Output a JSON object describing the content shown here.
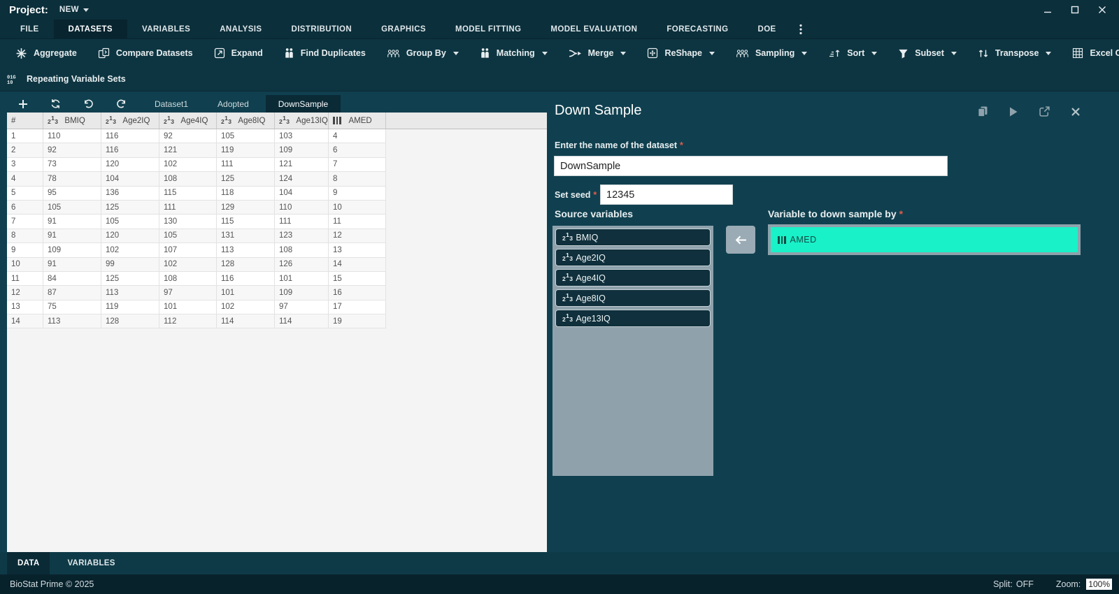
{
  "window": {
    "app_label": "Project:",
    "project_name": "NEW"
  },
  "menu": {
    "items": [
      "FILE",
      "DATASETS",
      "VARIABLES",
      "ANALYSIS",
      "DISTRIBUTION",
      "GRAPHICS",
      "MODEL FITTING",
      "MODEL EVALUATION",
      "FORECASTING",
      "DOE"
    ],
    "active": "DATASETS"
  },
  "toolbar": {
    "row1": [
      {
        "label": "Aggregate",
        "icon": "aggregate",
        "dropdown": false
      },
      {
        "label": "Compare Datasets",
        "icon": "compare",
        "dropdown": false
      },
      {
        "label": "Expand",
        "icon": "expand",
        "dropdown": false
      },
      {
        "label": "Find Duplicates",
        "icon": "people2",
        "dropdown": false
      },
      {
        "label": "Group By",
        "icon": "people3",
        "dropdown": true
      },
      {
        "label": "Matching",
        "icon": "people2",
        "dropdown": true
      },
      {
        "label": "Merge",
        "icon": "merge",
        "dropdown": true
      },
      {
        "label": "ReShape",
        "icon": "reshape",
        "dropdown": true
      },
      {
        "label": "Sampling",
        "icon": "people3",
        "dropdown": true
      },
      {
        "label": "Sort",
        "icon": "sort",
        "dropdown": true
      },
      {
        "label": "Subset",
        "icon": "subset",
        "dropdown": true
      },
      {
        "label": "Transpose",
        "icon": "transpose",
        "dropdown": true
      },
      {
        "label": "Excel Cleanup",
        "icon": "excel",
        "dropdown": false
      }
    ],
    "row2": [
      {
        "label": "Repeating Variable Sets",
        "icon": "repeating",
        "dropdown": false
      }
    ]
  },
  "dataset_tabs": {
    "actions": [
      {
        "name": "add-dataset",
        "icon": "add"
      },
      {
        "name": "refresh",
        "icon": "refresh"
      },
      {
        "name": "undo",
        "icon": "undo"
      },
      {
        "name": "redo",
        "icon": "redo"
      }
    ],
    "tabs": [
      "Dataset1",
      "Adopted",
      "DownSample"
    ],
    "active": "DownSample"
  },
  "table": {
    "columns": [
      {
        "label": "#",
        "type": "index"
      },
      {
        "label": "BMIQ",
        "type": "numeric"
      },
      {
        "label": "Age2IQ",
        "type": "numeric"
      },
      {
        "label": "Age4IQ",
        "type": "numeric"
      },
      {
        "label": "Age8IQ",
        "type": "numeric"
      },
      {
        "label": "Age13IQ",
        "type": "numeric"
      },
      {
        "label": "AMED",
        "type": "factor"
      }
    ],
    "rows": [
      [
        1,
        110,
        116,
        92,
        105,
        103,
        4
      ],
      [
        2,
        92,
        116,
        121,
        119,
        109,
        6
      ],
      [
        3,
        73,
        120,
        102,
        111,
        121,
        7
      ],
      [
        4,
        78,
        104,
        108,
        125,
        124,
        8
      ],
      [
        5,
        95,
        136,
        115,
        118,
        104,
        9
      ],
      [
        6,
        105,
        125,
        111,
        129,
        110,
        10
      ],
      [
        7,
        91,
        105,
        130,
        115,
        111,
        11
      ],
      [
        8,
        91,
        120,
        105,
        131,
        123,
        12
      ],
      [
        9,
        109,
        102,
        107,
        113,
        108,
        13
      ],
      [
        10,
        91,
        99,
        102,
        128,
        126,
        14
      ],
      [
        11,
        84,
        125,
        108,
        116,
        101,
        15
      ],
      [
        12,
        87,
        113,
        97,
        101,
        109,
        16
      ],
      [
        13,
        75,
        119,
        101,
        102,
        97,
        17
      ],
      [
        14,
        113,
        128,
        112,
        114,
        114,
        19
      ]
    ]
  },
  "panel": {
    "title": "Down Sample",
    "name_label": "Enter the name of the dataset",
    "name_value": "DownSample",
    "seed_label": "Set seed",
    "seed_value": "12345",
    "source_label": "Source variables",
    "target_label": "Variable to down sample by",
    "required_marker": "*",
    "source_variables": [
      {
        "name": "BMIQ",
        "type": "numeric"
      },
      {
        "name": "Age2IQ",
        "type": "numeric"
      },
      {
        "name": "Age4IQ",
        "type": "numeric"
      },
      {
        "name": "Age8IQ",
        "type": "numeric"
      },
      {
        "name": "Age13IQ",
        "type": "numeric"
      }
    ],
    "target_variable": {
      "name": "AMED",
      "type": "factor"
    }
  },
  "bottom_tabs": {
    "items": [
      "DATA",
      "VARIABLES"
    ],
    "active": "DATA"
  },
  "status": {
    "left": "BioStat Prime © 2025",
    "split_label": "Split:",
    "split_value": "OFF",
    "zoom_label": "Zoom:",
    "zoom_value": "100%"
  },
  "colors": {
    "accent_teal": "#19f1c8",
    "background": "#10404f",
    "titlebar": "#0b2f3b",
    "statusbar": "#08222c",
    "required": "#e25b4a"
  }
}
